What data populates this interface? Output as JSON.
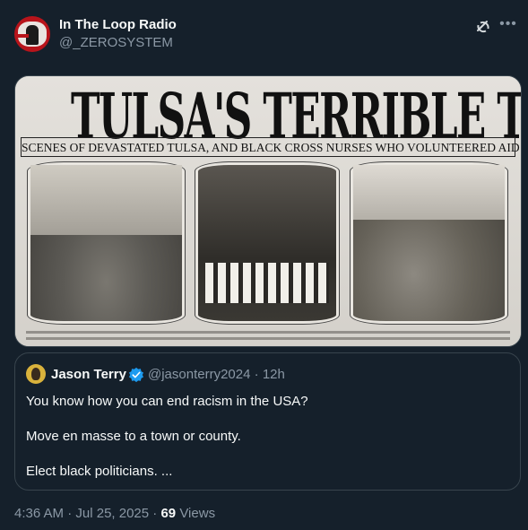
{
  "author": {
    "display_name": "In The Loop Radio",
    "handle": "@_ZEROSYSTEM"
  },
  "icons": {
    "grok": "grok-icon",
    "more": "more-icon",
    "verified": "verified-badge-icon"
  },
  "media": {
    "headline": "TULSA'S TERRIBLE TALE IS TOLD",
    "subhead": "SCENES OF DEVASTATED TULSA, AND BLACK CROSS NURSES WHO VOLUNTEERED AID"
  },
  "quoted_post": {
    "display_name": "Jason Terry",
    "handle": "@jasonterry2024",
    "separator": "·",
    "time": "12h",
    "paragraphs": [
      "You know how you can end racism in the USA?",
      "Move en masse to a town or county.",
      "Elect black politicians. ..."
    ]
  },
  "meta": {
    "time": "4:36 AM",
    "separator": "·",
    "date": "Jul 25, 2025",
    "views_count": "69",
    "views_label": "Views"
  },
  "colors": {
    "background": "#15202b",
    "text": "#f7f9f9",
    "secondary": "#8b98a5",
    "border": "#38444d",
    "verified": "#1d9bf0"
  }
}
